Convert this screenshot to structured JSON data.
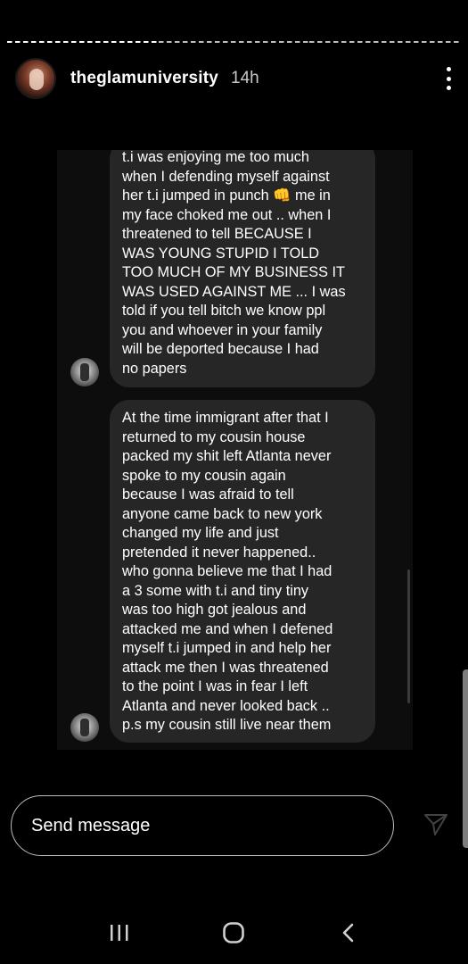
{
  "story": {
    "username": "theglamuniversity",
    "time_ago": "14h",
    "more_icon": "more-vertical-icon"
  },
  "screenshot": {
    "messages": [
      {
        "text": "t.i was enjoying me too much\nwhen I defending myself against\nher t.i jumped in punch 👊 me in\nmy face choked me out .. when I\nthreatened to tell BECAUSE I\nWAS YOUNG STUPID I TOLD\nTOO MUCH OF MY BUSINESS IT\nWAS USED AGAINST ME ... I was\ntold if you tell bitch we know ppl\nyou and whoever in your family\nwill be deported because I had\nno papers"
      },
      {
        "text": "At the time immigrant after that  I\nreturned to my cousin house\npacked my shit left Atlanta never\nspoke to my cousin again\nbecause I was afraid to tell\nanyone came back to new york\nchanged my life and just\npretended it never happened..\nwho gonna believe me that I had\na 3 some with t.i and tiny tiny\nwas too high got jealous and\nattacked me and when I defened\nmyself t.i jumped in and help her\nattack me then I was threatened\nto the point I was in fear I left\nAtlanta and never looked back ..\np.s my cousin still live near them"
      }
    ]
  },
  "composer": {
    "placeholder": "Send message",
    "send_icon": "send-icon"
  },
  "navbar": {
    "recent_icon": "recent-apps-icon",
    "home_icon": "home-icon",
    "back_icon": "back-icon"
  },
  "colors": {
    "background": "#000000",
    "bubble": "#262626",
    "composer_border": "#bdbdbd"
  }
}
